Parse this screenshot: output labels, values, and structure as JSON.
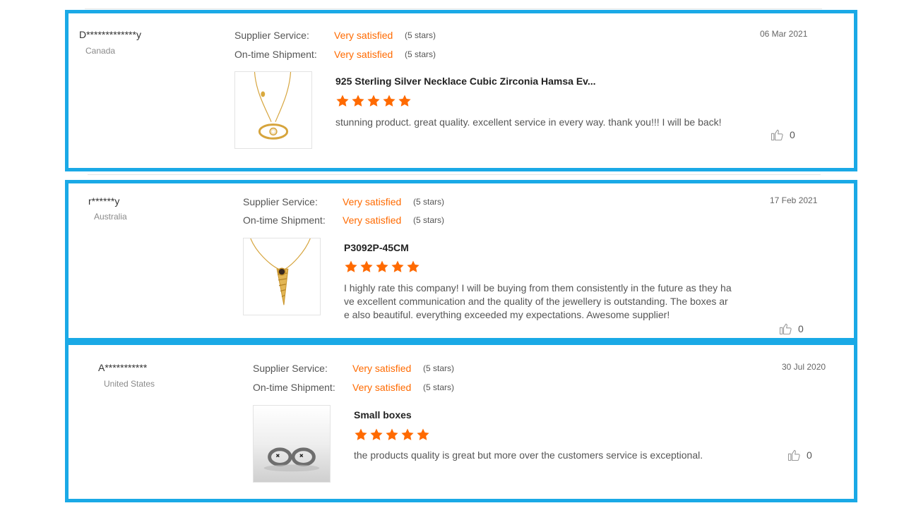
{
  "reviews": [
    {
      "user": "D*************y",
      "country": "Canada",
      "date": "06 Mar 2021",
      "supplier_label": "Supplier Service:",
      "supplier_value": "Very satisfied",
      "supplier_stars": "(5 stars)",
      "shipment_label": "On-time Shipment:",
      "shipment_value": "Very satisfied",
      "shipment_stars": "(5 stars)",
      "product_title": "925 Sterling Silver Necklace Cubic Zirconia Hamsa Ev...",
      "rating": 5,
      "text": "stunning product. great quality. excellent service in every way.  thank you!!!  I will be back!",
      "likes": "0",
      "image_icon": "eye-pendant-necklace"
    },
    {
      "user": "r******y",
      "country": "Australia",
      "date": "17 Feb 2021",
      "supplier_label": "Supplier Service:",
      "supplier_value": "Very satisfied",
      "supplier_stars": "(5 stars)",
      "shipment_label": "On-time Shipment:",
      "shipment_value": "Very satisfied",
      "shipment_stars": "(5 stars)",
      "product_title": "P3092P-45CM",
      "rating": 5,
      "text": "I highly rate this company! I will be buying from them consistently in the future as they have excellent communication and the quality of the jewellery is outstanding. The boxes are also beautiful. everything exceeded my expectations. Awesome supplier!",
      "likes": "0",
      "image_icon": "shell-pendant-necklace"
    },
    {
      "user": "A***********",
      "country": "United States",
      "date": "30 Jul 2020",
      "supplier_label": "Supplier Service:",
      "supplier_value": "Very satisfied",
      "supplier_stars": "(5 stars)",
      "shipment_label": "On-time Shipment:",
      "shipment_value": "Very satisfied",
      "shipment_stars": "(5 stars)",
      "product_title": "Small boxes",
      "rating": 5,
      "text": "the products quality is great but more over the customers service is exceptional.",
      "likes": "0",
      "image_icon": "hoop-earrings"
    }
  ],
  "colors": {
    "highlight_border": "#1aa9e6",
    "accent": "#ff6a00",
    "star": "#ff6a00"
  }
}
